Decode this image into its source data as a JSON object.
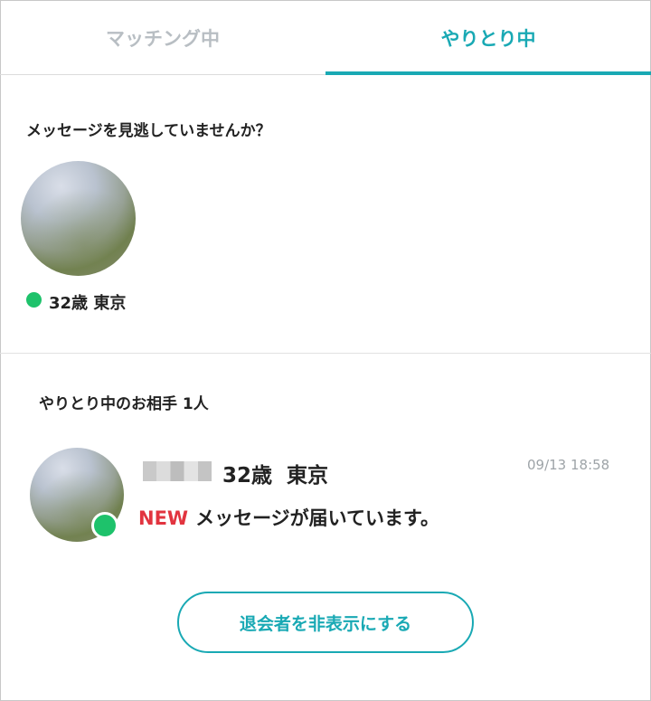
{
  "tabs": [
    {
      "label": "マッチング中",
      "active": false
    },
    {
      "label": "やりとり中",
      "active": true
    }
  ],
  "colors": {
    "accent": "#19a9b4",
    "online": "#1ec26b",
    "new_badge": "#e2343f",
    "inactive_tab": "#b8bec3",
    "time": "#9ea4a8"
  },
  "missed": {
    "title": "メッセージを見逃していませんか？",
    "profile": {
      "age": "32歳",
      "location": "東京",
      "online": true,
      "info": "32歳 東京"
    }
  },
  "conversations": {
    "title": "やりとり中のお相手 1人",
    "items": [
      {
        "age": "32歳",
        "location": "東京",
        "info": "32歳  東京",
        "time": "09/13 18:58",
        "new_label": "NEW",
        "message": "メッセージが届いています。",
        "online": true
      }
    ]
  },
  "hide_button": {
    "label": "退会者を非表示にする"
  }
}
